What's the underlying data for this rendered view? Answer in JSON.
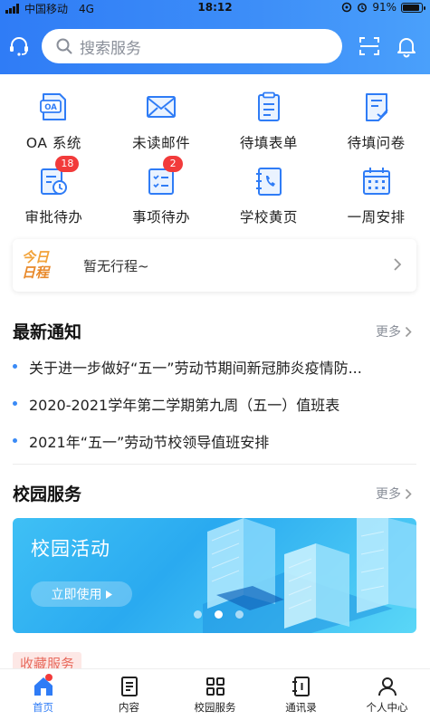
{
  "status_bar": {
    "carrier": "中国移动",
    "network": "4G",
    "time": "18:12",
    "battery": "91%",
    "battery_level": 0.91
  },
  "search": {
    "placeholder": "搜索服务"
  },
  "quick_apps": [
    {
      "label": "OA 系统",
      "icon": "oa-icon",
      "badge": ""
    },
    {
      "label": "未读邮件",
      "icon": "mail-icon",
      "badge": ""
    },
    {
      "label": "待填表单",
      "icon": "clipboard-icon",
      "badge": ""
    },
    {
      "label": "待填问卷",
      "icon": "questionnaire-icon",
      "badge": ""
    },
    {
      "label": "审批待办",
      "icon": "approval-icon",
      "badge": "18"
    },
    {
      "label": "事项待办",
      "icon": "checklist-icon",
      "badge": "2"
    },
    {
      "label": "学校黄页",
      "icon": "phonebook-icon",
      "badge": ""
    },
    {
      "label": "一周安排",
      "icon": "calendar-icon",
      "badge": ""
    }
  ],
  "schedule": {
    "logo_line1": "今日",
    "logo_line2": "日程",
    "text": "暂无行程~"
  },
  "news": {
    "title": "最新通知",
    "more": "更多",
    "items": [
      "关于进一步做好“五一”劳动节期间新冠肺炎疫情防...",
      "2020-2021学年第二学期第九周（五一）值班表",
      "2021年“五一”劳动节校领导值班安排"
    ]
  },
  "campus": {
    "title": "校园服务",
    "more": "更多",
    "banner_title": "校园活动",
    "banner_button": "立即使用",
    "carousel_index": 2,
    "carousel_count": 3
  },
  "favorites": {
    "label": "收藏服务"
  },
  "tabs": [
    {
      "label": "首页",
      "icon": "home-icon",
      "active": true
    },
    {
      "label": "内容",
      "icon": "document-icon",
      "active": false
    },
    {
      "label": "校园服务",
      "icon": "apps-grid-icon",
      "active": false
    },
    {
      "label": "通讯录",
      "icon": "contacts-icon",
      "active": false
    },
    {
      "label": "个人中心",
      "icon": "person-icon",
      "active": false
    }
  ],
  "colors": {
    "primary": "#2f7cf6",
    "badge": "#f23b3b",
    "banner": "#3fc0f5",
    "schedule_logo": "#f2a33a"
  }
}
